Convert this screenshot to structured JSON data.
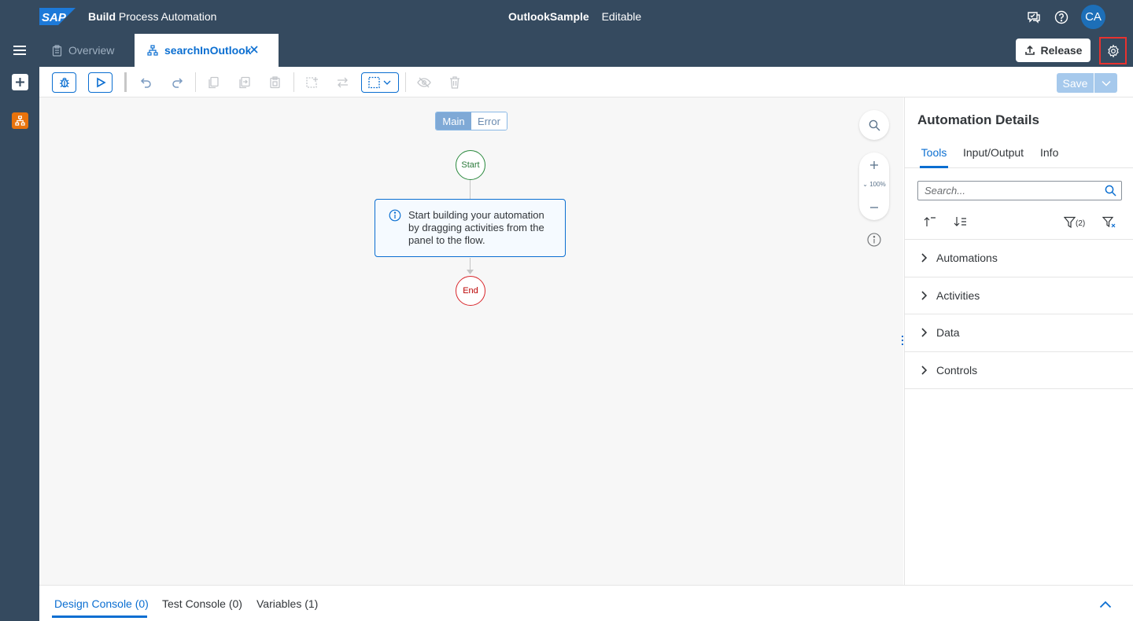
{
  "shell": {
    "logo_text": "SAP",
    "product_bold": "Build",
    "product_rest": "Process Automation",
    "project_name": "OutlookSample",
    "project_state": "Editable",
    "avatar_initials": "CA"
  },
  "tabs": {
    "overview_label": "Overview",
    "active_label": "searchInOutlook"
  },
  "header": {
    "release_label": "Release"
  },
  "toolbar": {
    "save_label": "Save"
  },
  "canvas": {
    "segment_main": "Main",
    "segment_error": "Error",
    "start_label": "Start",
    "end_label": "End",
    "info_text": "Start building your automation by dragging activities from the panel to the flow.",
    "zoom_level": "100%"
  },
  "panel": {
    "title": "Automation Details",
    "tabs": [
      "Tools",
      "Input/Output",
      "Info"
    ],
    "search_placeholder": "Search...",
    "filter_count": "(2)",
    "tree_items": [
      "Automations",
      "Activities",
      "Data",
      "Controls"
    ]
  },
  "console": {
    "tabs": [
      "Design Console (0)",
      "Test Console (0)",
      "Variables (1)"
    ]
  },
  "colors": {
    "shell_bg": "#354a5f",
    "accent": "#0a6ed1",
    "highlight_border": "#e8322f",
    "start_green": "#2b8a3e",
    "end_red": "#d9262b"
  }
}
